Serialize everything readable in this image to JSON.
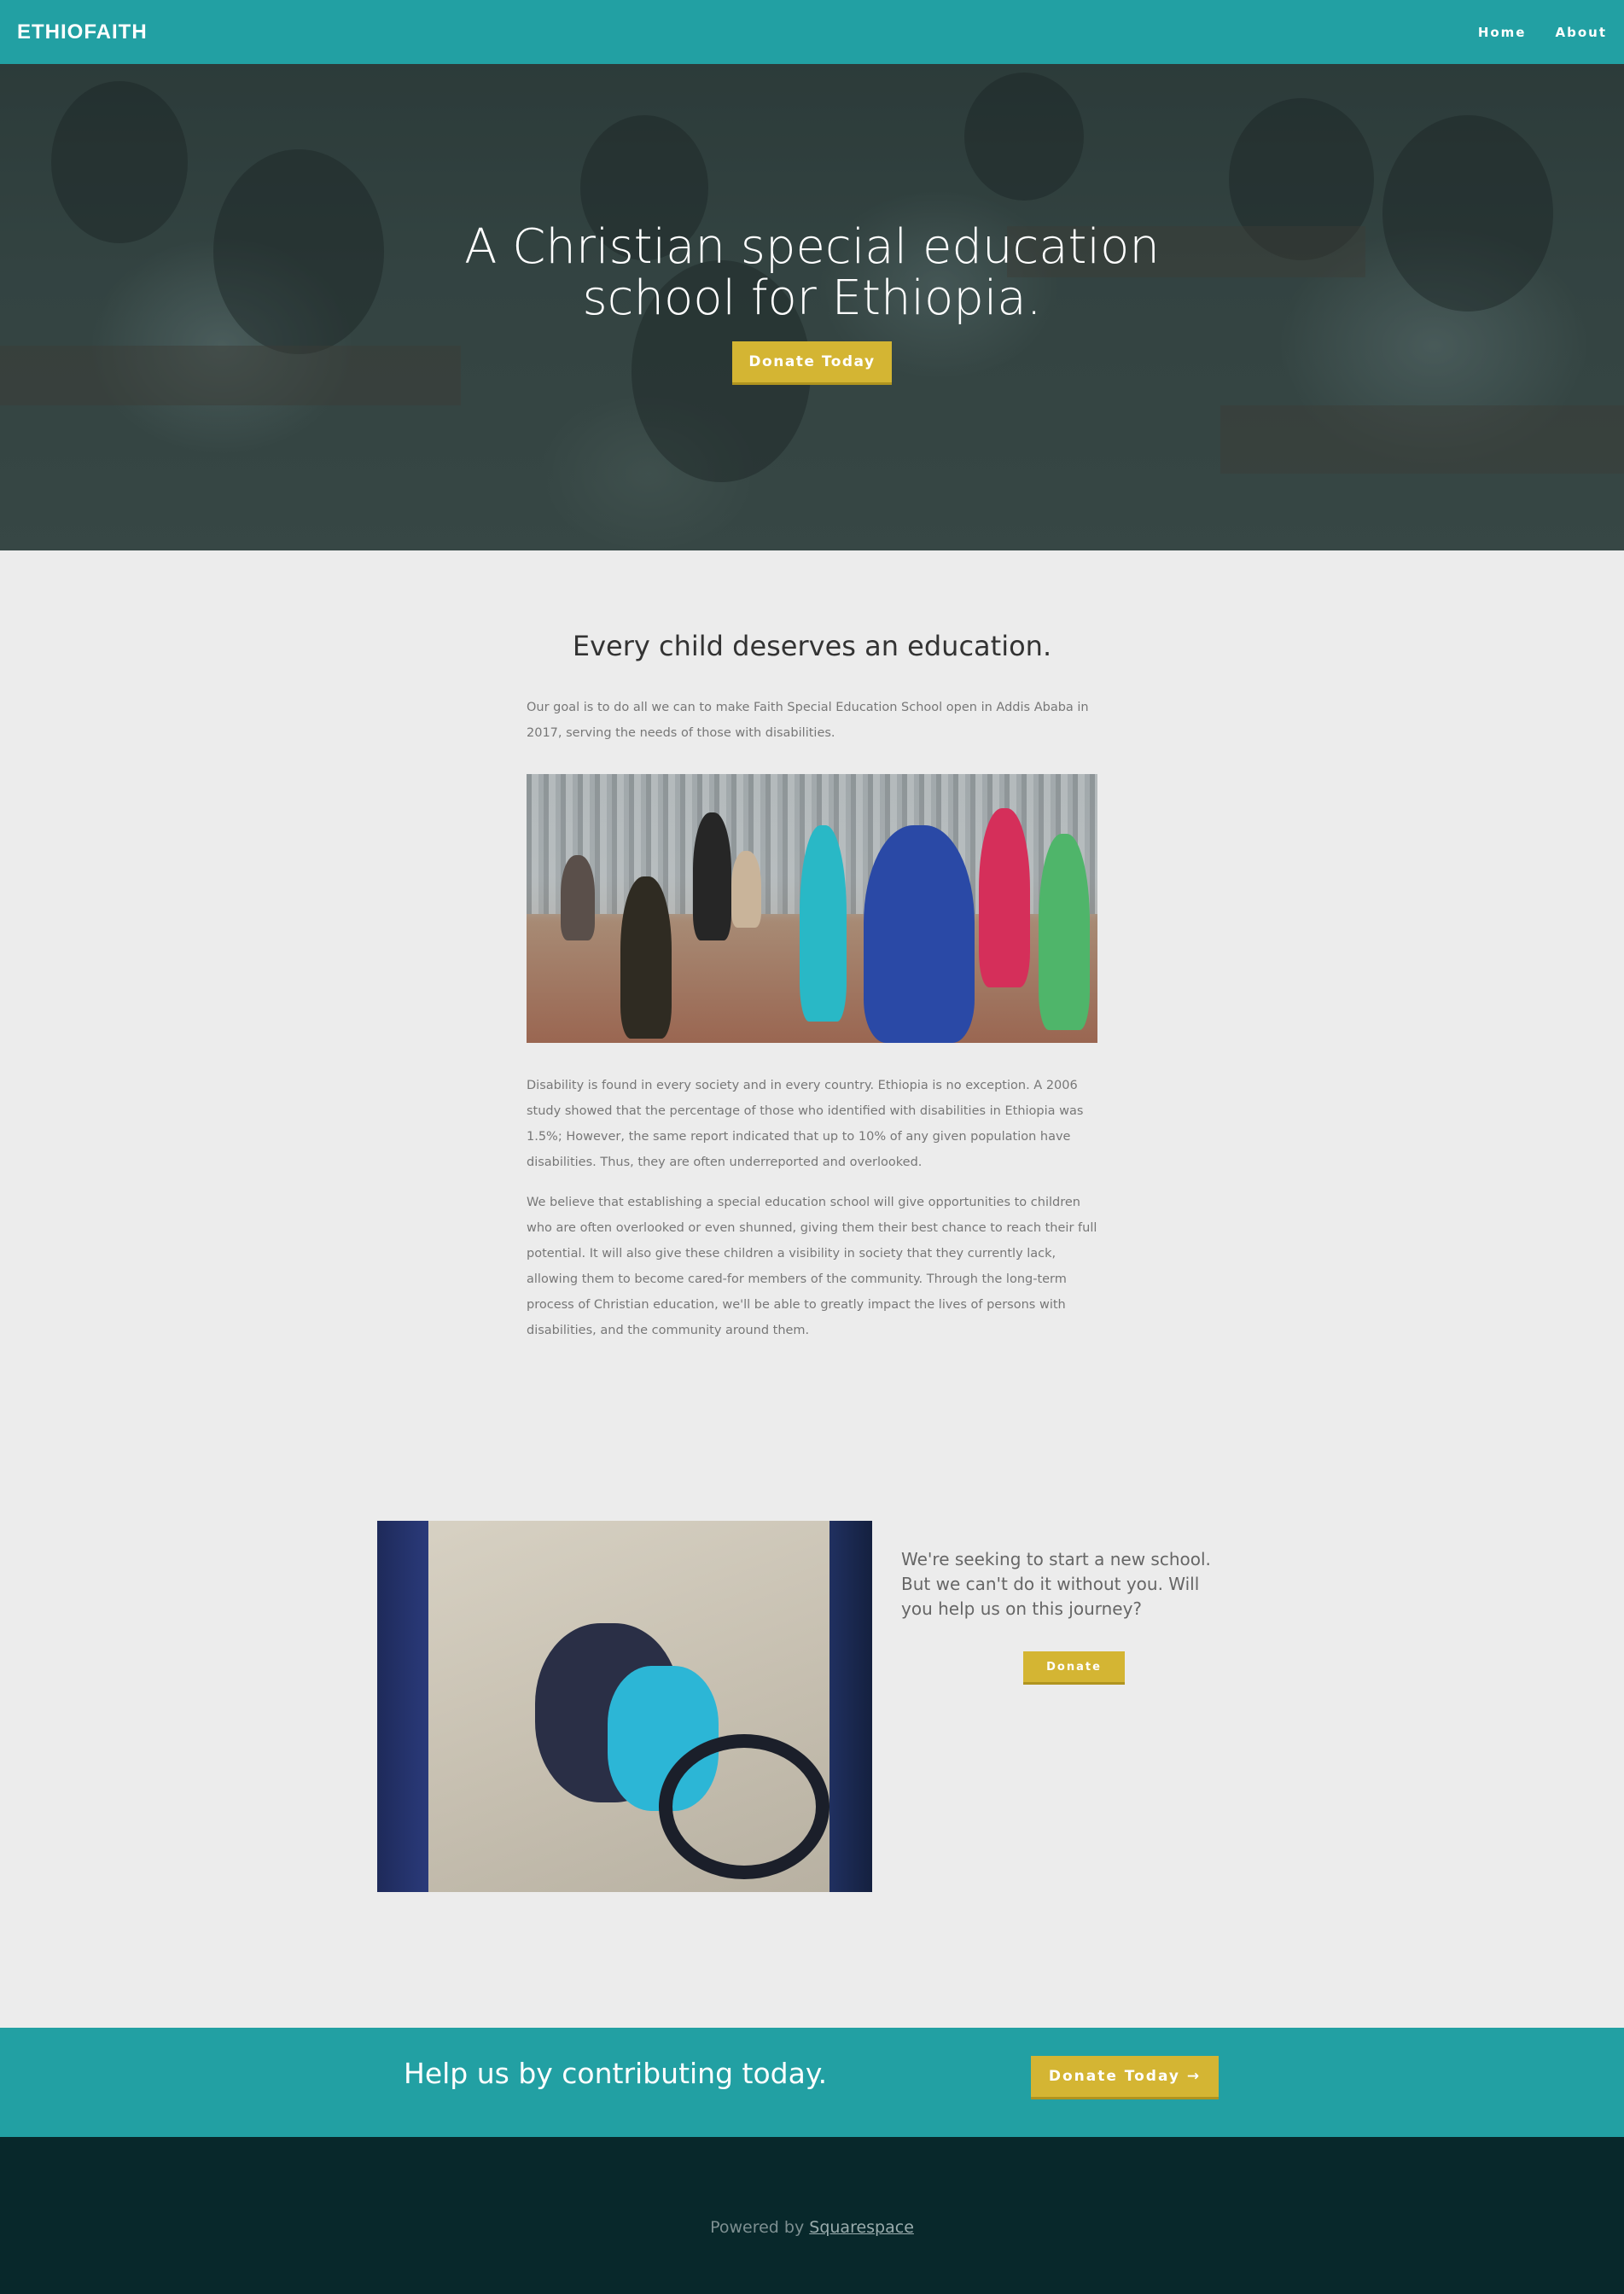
{
  "nav": {
    "brand": "ETHIOFAITH",
    "links": [
      {
        "label": "Home"
      },
      {
        "label": "About"
      }
    ]
  },
  "hero": {
    "title": "A Christian special education school for Ethiopia.",
    "button": "Donate Today"
  },
  "intro": {
    "title": "Every child deserves an education.",
    "goal": "Our goal is to do all we can to make Faith Special Education School open in Addis Ababa in 2017, serving the needs of those with disabilities.",
    "paragraph1": "Disability is found in every society and in every country. Ethiopia is no exception. A 2006 study showed that the percentage of those who identified with disabilities in Ethiopia was 1.5%; However, the same report indicated that up to 10% of any given population have disabilities. Thus, they are often underreported and overlooked.",
    "paragraph2": "We believe that establishing a special education school will give opportunities to children who are often overlooked or even shunned, giving them their best chance to reach their full potential. It will also give these children a visibility in society that they currently lack, allowing them to become cared-for members of the community. Through the long-term process of Christian education, we'll be able to greatly impact the lives of persons with disabilities, and the community around them."
  },
  "seeking": {
    "text": "We're seeking to start a new school. But we can't do it without you. Will you help us on this journey?",
    "button": "Donate"
  },
  "cta": {
    "text": "Help us by contributing today.",
    "button": "Donate Today →"
  },
  "footer": {
    "prefix": "Powered by",
    "link": "Squarespace"
  },
  "colors": {
    "teal": "#22a0a3",
    "gold": "#d4b533",
    "footer": "#08282b",
    "background": "#ececec"
  }
}
